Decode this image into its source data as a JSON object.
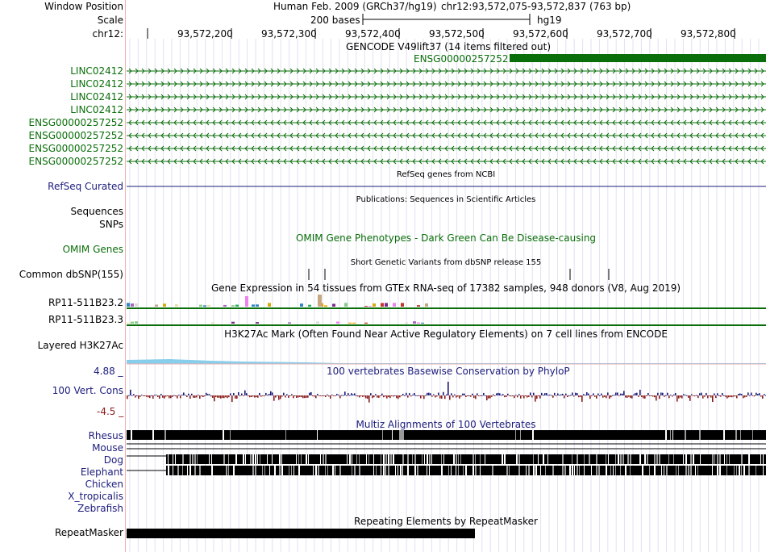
{
  "header": {
    "window_position_label": "Window Position",
    "scale_label": "Scale",
    "chrom_label": "chr12:",
    "assembly": "Human Feb. 2009 (GRCh37/hg19)",
    "position": "chr12:93,572,075-93,572,837 (763 bp)",
    "scale_text": "200 bases",
    "db": "hg19",
    "ruler_ticks": [
      "93,572,200",
      "93,572,300",
      "93,572,400",
      "93,572,500",
      "93,572,600",
      "93,572,700",
      "93,572,800"
    ]
  },
  "gencode": {
    "title": "GENCODE V49lift37 (14 items filtered out)",
    "top_item": "ENSG00000257252",
    "color": "#0a6e0a",
    "rows": [
      {
        "label": "LINC02412",
        "strand": "+"
      },
      {
        "label": "LINC02412",
        "strand": "+"
      },
      {
        "label": "LINC02412",
        "strand": "+"
      },
      {
        "label": "LINC02412",
        "strand": "+"
      },
      {
        "label": "ENSG00000257252",
        "strand": "-"
      },
      {
        "label": "ENSG00000257252",
        "strand": "-"
      },
      {
        "label": "ENSG00000257252",
        "strand": "-"
      },
      {
        "label": "ENSG00000257252",
        "strand": "-"
      }
    ]
  },
  "refseq": {
    "title": "RefSeq genes from NCBI",
    "label": "RefSeq Curated",
    "color": "#1c1c7c"
  },
  "publications": {
    "title": "Publications: Sequences in Scientific Articles",
    "label": "Sequences",
    "label2": "SNPs"
  },
  "omim": {
    "title": "OMIM Gene Phenotypes - Dark Green Can Be Disease-causing",
    "label": "OMIM Genes",
    "color": "#0a6e0a"
  },
  "dbsnp": {
    "title": "Short Genetic Variants from dbSNP release 155",
    "label": "Common dbSNP(155)"
  },
  "gtex": {
    "title": "Gene Expression in 54 tissues from GTEx RNA-seq of 17382 samples, 948 donors (V8, Aug 2019)",
    "rows": [
      "RP11-511B23.2",
      "RP11-511B23.3"
    ]
  },
  "h3k27ac": {
    "title": "H3K27Ac Mark (Often Found Near Active Regulatory Elements) on 7 cell lines from ENCODE",
    "label": "Layered H3K27Ac"
  },
  "conservation": {
    "title": "100 vertebrates Basewise Conservation by PhyloP",
    "label": "100 Vert. Cons",
    "max": "4.88 _",
    "min": "-4.5 _",
    "color": "#1c1c7c"
  },
  "multiz": {
    "title": "Multiz Alignments of 100 Vertebrates",
    "species": [
      "Rhesus",
      "Mouse",
      "Dog",
      "Elephant",
      "Chicken",
      "X_tropicalis",
      "Zebrafish"
    ]
  },
  "repeatmasker": {
    "title": "Repeating Elements by RepeatMasker",
    "label": "RepeatMasker"
  }
}
